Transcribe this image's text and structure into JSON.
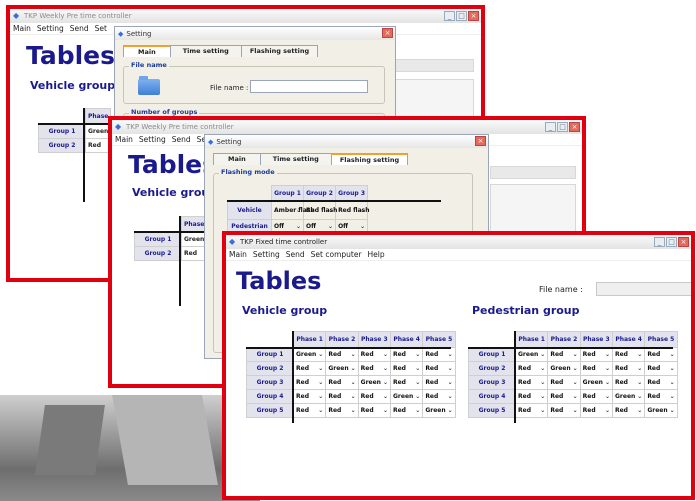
{
  "windows": {
    "w1": {
      "title": "TKP  Weekly Pre time controller",
      "menu": [
        "Main",
        "Setting",
        "Send",
        "Set"
      ],
      "tables_title": "Tables",
      "vehicle_group": "Vehicle group",
      "phase_header": "Phase",
      "rows": [
        {
          "label": "Group 1",
          "value": "Green"
        },
        {
          "label": "Group 2",
          "value": "Red"
        }
      ],
      "dialog": {
        "title": "Setting",
        "tabs": [
          "Main",
          "Time setting",
          "Flashing setting"
        ],
        "file_name_group": "File name",
        "file_name_label": "File name :",
        "number_of_groups": "Number of groups"
      }
    },
    "w2": {
      "title": "TKP  Weekly Pre time controller",
      "menu": [
        "Main",
        "Setting",
        "Send",
        "Set"
      ],
      "tables_title": "Tables",
      "vehicle_group": "Vehicle group",
      "phase_header": "Phase",
      "rows": [
        {
          "label": "Group 1",
          "value": "Green"
        },
        {
          "label": "Group 2",
          "value": "Red"
        }
      ],
      "dialog": {
        "title": "Setting",
        "tabs": [
          "Main",
          "Time setting",
          "Flashing setting"
        ],
        "flashing_mode": "Flashing mode",
        "columns": [
          "Group 1",
          "Group 2",
          "Group 3"
        ],
        "rows": [
          {
            "label": "Vehicle",
            "values": [
              "Amber flash",
              "Red flash",
              "Red flash"
            ]
          },
          {
            "label": "Pedestrian",
            "values": [
              "Off",
              "Off",
              "Off"
            ]
          }
        ]
      }
    },
    "w3": {
      "title": "TKP  Fixed time controller",
      "menu": [
        "Main",
        "Setting",
        "Send",
        "Set computer",
        "Help"
      ],
      "tables_title": "Tables",
      "file_name_label": "File name :",
      "vehicle_group": "Vehicle group",
      "pedestrian_group": "Pedestrian group",
      "phases": [
        "Phase 1",
        "Phase 2",
        "Phase 3",
        "Phase 4",
        "Phase 5"
      ],
      "vehicle_rows": [
        {
          "label": "Group 1",
          "values": [
            "Green",
            "Red",
            "Red",
            "Red",
            "Red"
          ]
        },
        {
          "label": "Group 2",
          "values": [
            "Red",
            "Green",
            "Red",
            "Red",
            "Red"
          ]
        },
        {
          "label": "Group 3",
          "values": [
            "Red",
            "Red",
            "Green",
            "Red",
            "Red"
          ]
        },
        {
          "label": "Group 4",
          "values": [
            "Red",
            "Red",
            "Red",
            "Green",
            "Red"
          ]
        },
        {
          "label": "Group 5",
          "values": [
            "Red",
            "Red",
            "Red",
            "Red",
            "Green"
          ]
        }
      ],
      "pedestrian_rows": [
        {
          "label": "Group 1",
          "values": [
            "Green",
            "Red",
            "Red",
            "Red",
            "Red"
          ]
        },
        {
          "label": "Group 2",
          "values": [
            "Red",
            "Green",
            "Red",
            "Red",
            "Red"
          ]
        },
        {
          "label": "Group 3",
          "values": [
            "Red",
            "Red",
            "Green",
            "Red",
            "Red"
          ]
        },
        {
          "label": "Group 4",
          "values": [
            "Red",
            "Red",
            "Red",
            "Green",
            "Red"
          ]
        },
        {
          "label": "Group 5",
          "values": [
            "Red",
            "Red",
            "Red",
            "Red",
            "Green"
          ]
        }
      ]
    }
  },
  "colors": {
    "frame": "#e00010",
    "heading": "#1a1a8c",
    "header_cell": "#e3e3ee"
  },
  "icons": {
    "app": "tkp-logo-icon",
    "close": "close-icon",
    "minimize": "minimize-icon",
    "maximize": "maximize-icon",
    "dropdown": "chevron-down-icon",
    "folder": "folder-icon"
  }
}
